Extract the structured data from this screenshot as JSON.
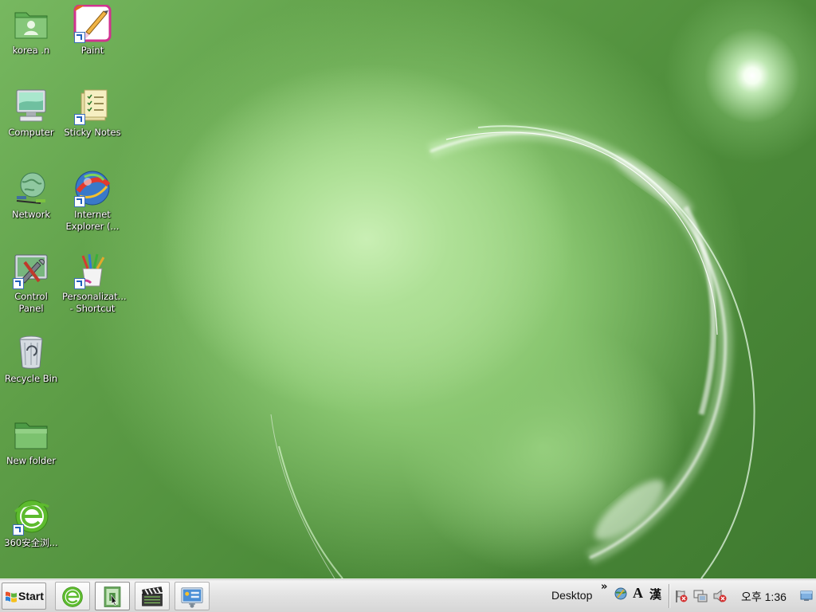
{
  "desktop": {
    "icons": [
      {
        "label": "korea .n",
        "icon": "user-folder-icon"
      },
      {
        "label": "Paint",
        "icon": "paint-icon"
      },
      {
        "label": "Computer",
        "icon": "computer-icon"
      },
      {
        "label": "Sticky Notes",
        "icon": "sticky-notes-icon"
      },
      {
        "label": "Network",
        "icon": "network-icon"
      },
      {
        "label": "Internet Explorer (...",
        "icon": "internet-explorer-icon"
      },
      {
        "label": "Control Panel",
        "icon": "control-panel-icon"
      },
      {
        "label": "Personalizat... - Shortcut",
        "icon": "personalization-icon"
      },
      {
        "label": "Recycle Bin",
        "icon": "recycle-bin-icon"
      },
      {
        "label": "New folder",
        "icon": "folder-icon"
      },
      {
        "label": "360安全浏...",
        "icon": "360-browser-icon"
      }
    ]
  },
  "taskbar": {
    "start_label": "Start",
    "pinned": [
      {
        "name": "360-browser",
        "icon": "360-browser-icon"
      },
      {
        "name": "file-manager",
        "icon": "file-manager-icon"
      },
      {
        "name": "video-player",
        "icon": "clapperboard-icon"
      },
      {
        "name": "control-panel",
        "icon": "control-panel-icon"
      }
    ],
    "tray": {
      "toolbar_label": "Desktop",
      "overflow_chevron": "»",
      "font_indicator": "A",
      "hanja_indicator": "漢",
      "clock": "오후 1:36"
    }
  },
  "colors": {
    "wallpaper_base": "#5f9f48",
    "wallpaper_glow": "#c9efb4",
    "taskbar": "#e2e2e2"
  }
}
